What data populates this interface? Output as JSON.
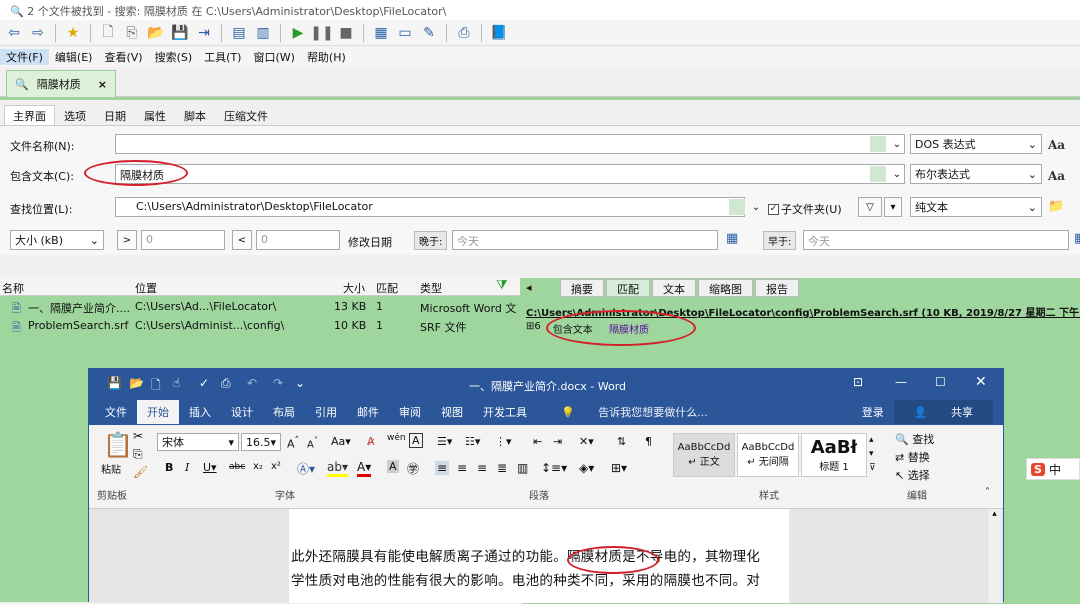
{
  "window": {
    "title": "2 个文件被找到 - 搜索: 隔膜材质 在 C:\\Users\\Administrator\\Desktop\\FileLocator\\"
  },
  "menu": [
    "文件(F)",
    "编辑(E)",
    "查看(V)",
    "搜索(S)",
    "工具(T)",
    "窗口(W)",
    "帮助(H)"
  ],
  "doc_tab": {
    "label": "隔膜材质",
    "close": "×"
  },
  "sub_tabs": [
    "主界面",
    "选项",
    "日期",
    "属性",
    "脚本",
    "压缩文件"
  ],
  "form": {
    "filename_label": "文件名称(N):",
    "filename_value": "",
    "filename_mode": "DOS 表达式",
    "content_label": "包含文本(C):",
    "content_value": "隔膜材质",
    "content_mode": "布尔表达式",
    "location_label": "查找位置(L):",
    "location_value": "C:\\Users\\Administrator\\Desktop\\FileLocator",
    "subfolder_label": "子文件夹(U)",
    "location_mode": "纯文本",
    "size_label": "大小 (kB)",
    "size_gt": ">",
    "size_min": "0",
    "size_lt": "<",
    "size_max": "0",
    "date_label": "修改日期",
    "after_label": "晚于:",
    "after_value": "今天",
    "before_label": "早于:",
    "before_value": "今天",
    "aa_label": "Aa"
  },
  "results": {
    "columns": [
      "名称",
      "位置",
      "大小",
      "匹配",
      "类型"
    ],
    "rows": [
      {
        "name": "一、隔膜产业简介....",
        "location": "C:\\Users\\Ad...\\FileLocator\\",
        "size": "13 KB",
        "matches": "1",
        "type": "Microsoft Word 文"
      },
      {
        "name": "ProblemSearch.srf",
        "location": "C:\\Users\\Administ...\\config\\",
        "size": "10 KB",
        "matches": "1",
        "type": "SRF 文件"
      }
    ]
  },
  "preview": {
    "tabs": [
      "摘要",
      "匹配",
      "文本",
      "缩略图",
      "报告"
    ],
    "path_line": "C:\\Users\\Administrator\\Desktop\\FileLocator\\config\\ProblemSearch.srf  (10 KB, 2019/8/27 星期二 下午 1:30:04)",
    "line_no": "6",
    "match_prefix": "包含文本",
    "match_term": "隔膜材质"
  },
  "word": {
    "title": "一、隔膜产业简介.docx - Word",
    "tabs": [
      "文件",
      "开始",
      "插入",
      "设计",
      "布局",
      "引用",
      "邮件",
      "审阅",
      "视图",
      "开发工具"
    ],
    "tell_me": "告诉我您想要做什么...",
    "login": "登录",
    "share": "共享",
    "font_name": "宋体",
    "font_size": "16.5",
    "paste_label": "粘贴",
    "groups": [
      "剪贴板",
      "字体",
      "段落",
      "样式",
      "编辑"
    ],
    "styles": [
      {
        "sample": "AaBbCcDd",
        "name": "↵ 正文"
      },
      {
        "sample": "AaBbCcDd",
        "name": "↵ 无间隔"
      },
      {
        "sample": "AaBł",
        "name": "标题 1"
      }
    ],
    "find": "查找",
    "replace": "替换",
    "select": "选择",
    "text_lines": [
      "此外还隔膜具有能使电解质离子通过的功能。隔膜材质是不导电的，其物理化",
      "学性质对电池的性能有很大的影响。电池的种类不同，采用的隔膜也不同。对"
    ]
  },
  "ime": {
    "label": "中"
  }
}
